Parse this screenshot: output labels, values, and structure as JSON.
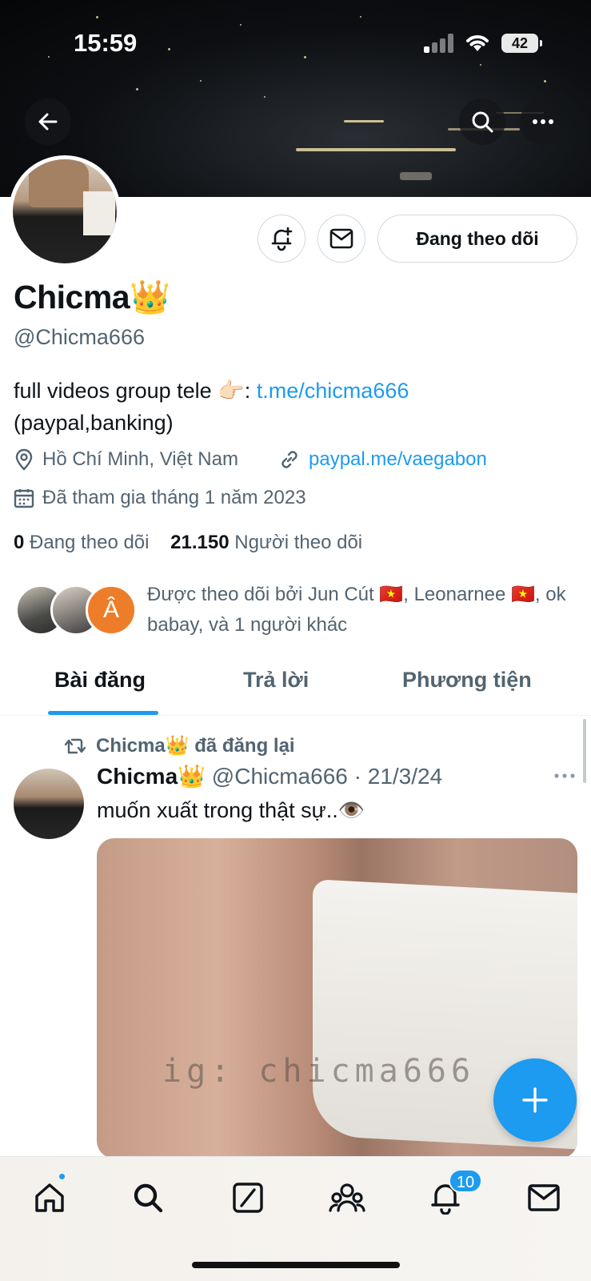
{
  "status_bar": {
    "time": "15:59",
    "battery": "42"
  },
  "profile": {
    "display_name": "Chicma👑",
    "handle": "@Chicma666",
    "bio_text": "full videos group tele 👉🏻: ",
    "bio_link": "t.me/chicma666",
    "bio_line2": "(paypal,banking)",
    "location": "Hồ Chí Minh, Việt Nam",
    "website": "paypal.me/vaegabon",
    "joined": "Đã tham gia tháng 1 năm 2023",
    "following_count": "0",
    "following_label": "Đang theo dõi",
    "followers_count": "21.150",
    "followers_label": "Người theo dõi",
    "followed_by": "Được theo dõi bởi Jun Cút 🇻🇳, Leonarnee 🇻🇳, ok babay, và 1 người khác",
    "followed_avatar_letter": "Â"
  },
  "actions": {
    "follow_label": "Đang theo dõi"
  },
  "tabs": [
    {
      "label": "Bài đăng",
      "active": true
    },
    {
      "label": "Trả lời",
      "active": false
    },
    {
      "label": "Phương tiện",
      "active": false
    }
  ],
  "post": {
    "repost_label": "Chicma👑 đã đăng lại",
    "author_name": "Chicma👑",
    "author_handle": "@Chicma666",
    "separator": " · ",
    "date": "21/3/24",
    "text": "muốn xuất trong thật sự..👁️",
    "media_watermark": "ig: chicma666"
  },
  "bottom_nav": {
    "items": [
      "home-icon",
      "search-icon",
      "grok-icon",
      "communities-icon",
      "notifications-icon",
      "messages-icon"
    ],
    "notification_count": "10"
  },
  "colors": {
    "accent": "#1d9bf0",
    "text_primary": "#0f1419",
    "text_secondary": "#536471"
  }
}
